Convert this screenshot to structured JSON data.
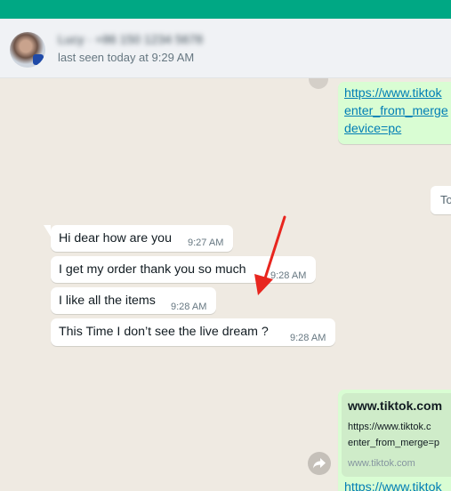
{
  "header": {
    "contact_name": "Lucy · +86 150 1234 5678",
    "status": "last seen today at 9:29 AM"
  },
  "messages": [
    {
      "text": "Hi dear how are you",
      "time": "9:27 AM"
    },
    {
      "text": "I get my order thank you so much",
      "time": "9:28 AM"
    },
    {
      "text": "I like all the items",
      "time": "9:28 AM"
    },
    {
      "text": "This Time I don’t see the live dream ?",
      "time": "9:28 AM"
    }
  ],
  "outgoing_top": {
    "lines": [
      "https://www.tiktok",
      "enter_from_merge",
      "device=pc"
    ]
  },
  "partial_chip": {
    "text": "To"
  },
  "link_preview": {
    "title": "www.tiktok.com",
    "desc_lines": [
      "https://www.tiktok.c",
      "enter_from_merge=p"
    ],
    "domain": "www.tiktok.com",
    "link_text": "https://www.tiktok"
  },
  "icons": {
    "forward": "forward-icon",
    "arrow": "red-annotation-arrow"
  },
  "colors": {
    "accent": "#00a884",
    "annotation": "#e8261f"
  }
}
